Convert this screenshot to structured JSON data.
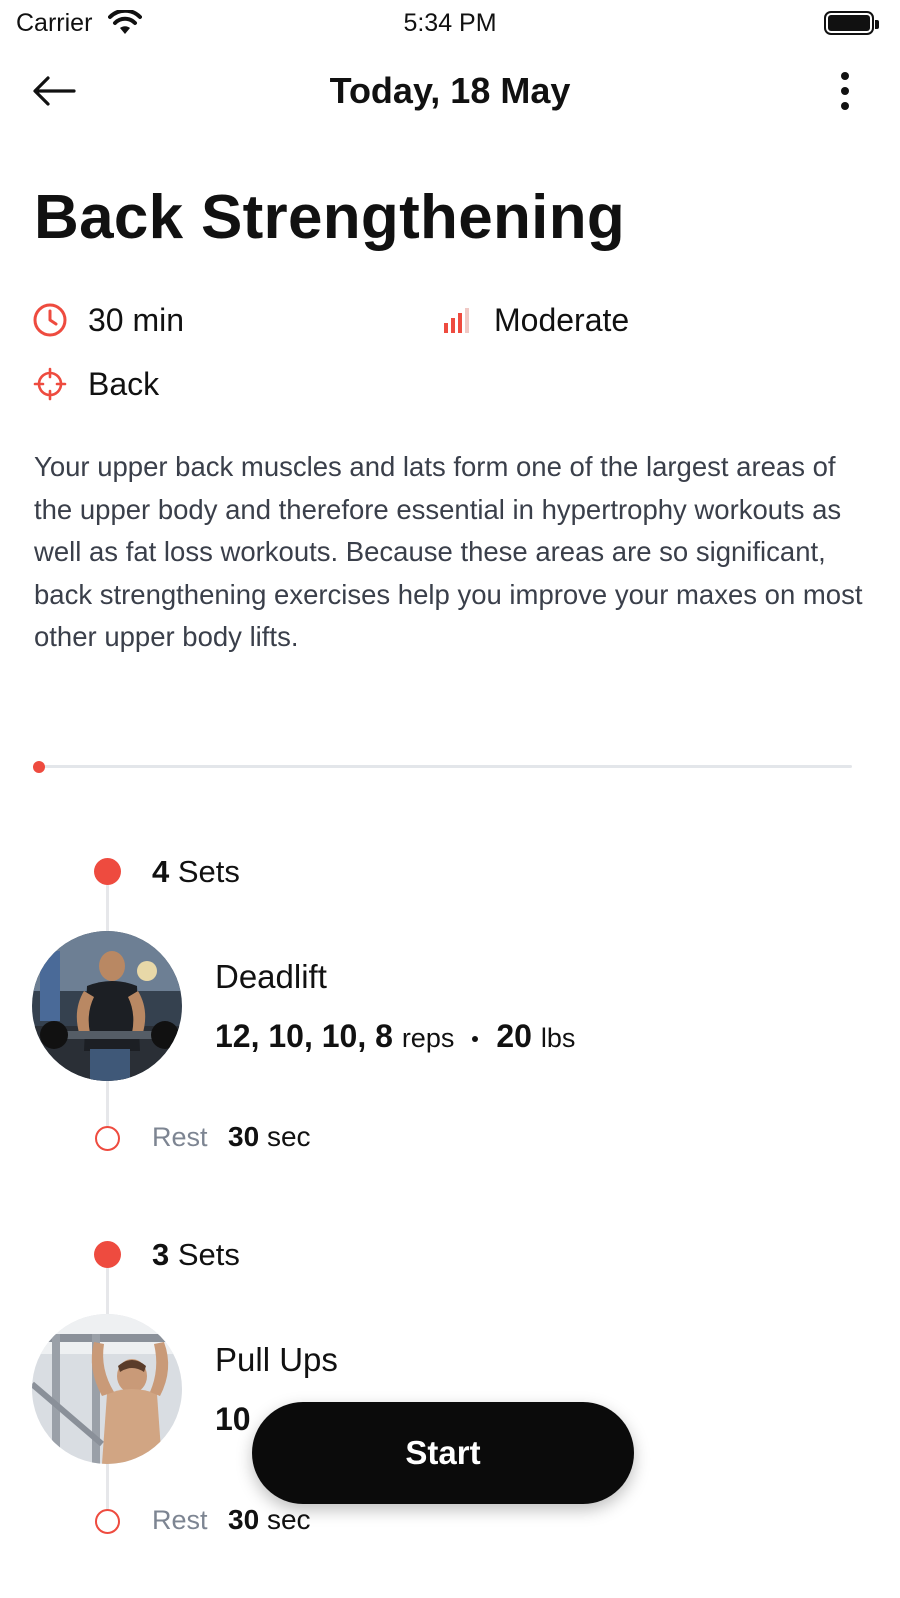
{
  "status_bar": {
    "carrier": "Carrier",
    "time": "5:34 PM"
  },
  "nav": {
    "title": "Today, 18 May",
    "back_icon": "arrow-left-icon",
    "more_icon": "more-vertical-icon"
  },
  "workout": {
    "title": "Back Strengthening",
    "duration": "30 min",
    "level": "Moderate",
    "target": "Back",
    "description": "Your upper back muscles and lats form one of the largest areas of the upper body and therefore essential in hypertrophy workouts as well as fat loss workouts. Because these areas are so significant, back strengthening exercises help you improve your maxes on most other upper body lifts.",
    "progress": 0
  },
  "exercises": [
    {
      "sets_count": "4",
      "sets_label": "Sets",
      "name": "Deadlift",
      "reps": "12, 10, 10, 8",
      "reps_unit": "reps",
      "weight": "20",
      "weight_unit": "lbs",
      "rest_label": "Rest",
      "rest_value": "30",
      "rest_unit": "sec"
    },
    {
      "sets_count": "3",
      "sets_label": "Sets",
      "name": "Pull Ups",
      "reps": "10",
      "rest_label": "Rest",
      "rest_value": "30",
      "rest_unit": "sec"
    }
  ],
  "actions": {
    "start_label": "Start"
  },
  "colors": {
    "accent": "#ee4b3f",
    "text": "#111111",
    "muted": "#7d8592",
    "button": "#0b0b0b"
  }
}
